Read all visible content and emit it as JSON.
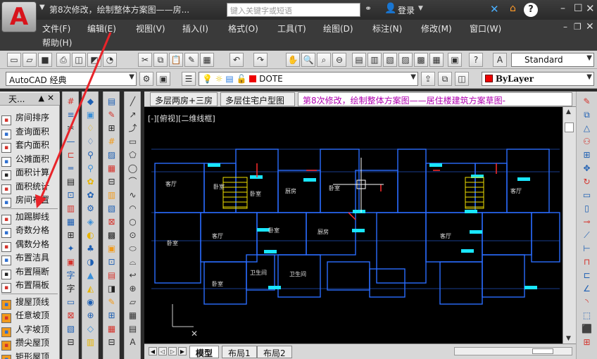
{
  "title_bar": {
    "app_logo": "A",
    "title": "第8次修改，绘制整体方案图——房...",
    "search_placeholder": "键入关键字或短语",
    "login": "登录",
    "help": "?",
    "icons": [
      "binoculars-icon",
      "user-icon",
      "exchange-icon",
      "store-icon",
      "help-icon"
    ]
  },
  "menu": {
    "items": [
      "文件(F)",
      "编辑(E)",
      "视图(V)",
      "插入(I)",
      "格式(O)",
      "工具(T)",
      "绘图(D)",
      "标注(N)",
      "修改(M)",
      "窗口(W)"
    ],
    "help": "帮助(H)"
  },
  "toolbar": {
    "text_style": "Standard",
    "workspace": "AutoCAD 经典",
    "layer": "DOTE",
    "color": "ByLayer"
  },
  "palette": {
    "title": "天...",
    "items": [
      {
        "label": "房间排序",
        "icon": "room-sort-icon"
      },
      {
        "label": "查询面积",
        "icon": "query-area-icon"
      },
      {
        "label": "套内面积",
        "icon": "suite-area-icon"
      },
      {
        "label": "公摊面积",
        "icon": "shared-area-icon"
      },
      {
        "label": "面积计算",
        "icon": "area-calc-icon"
      },
      {
        "label": "面积统计",
        "icon": "area-stats-icon"
      },
      {
        "label": "房间布置",
        "icon": "room-layout-icon"
      },
      {
        "label": "加踢脚线",
        "icon": "baseboard-icon"
      },
      {
        "label": "奇数分格",
        "icon": "odd-grid-icon"
      },
      {
        "label": "偶数分格",
        "icon": "even-grid-icon"
      },
      {
        "label": "布置洁具",
        "icon": "sanitary-icon"
      },
      {
        "label": "布置隔断",
        "icon": "partition-icon"
      },
      {
        "label": "布置隔板",
        "icon": "panel-icon"
      },
      {
        "label": "搜屋顶线",
        "icon": "roofline-icon"
      },
      {
        "label": "任意坡顶",
        "icon": "slope-roof-icon"
      },
      {
        "label": "人字坡顶",
        "icon": "gable-roof-icon"
      },
      {
        "label": "攒尖屋顶",
        "icon": "pyramid-roof-icon"
      },
      {
        "label": "矩形屋顶",
        "icon": "rect-roof-icon"
      }
    ]
  },
  "doc_tabs": [
    "多层两房+三房",
    "多层住宅户型图",
    "第8次修改，绘制整体方案图——居住楼建筑方案草图-"
  ],
  "viewport": {
    "label": "[-][俯视][二维线框]",
    "room_labels": [
      "客厅",
      "卧室",
      "卧室",
      "厨房",
      "卧室",
      "客厅",
      "卧室",
      "卧室",
      "厨房",
      "卧室",
      "卫生间",
      "卫生间",
      "客厅",
      "客厅"
    ]
  },
  "layout_tabs": [
    "模型",
    "布局1",
    "布局2"
  ],
  "colors": {
    "title_bg": "#2f2f2f",
    "toolbar_bg": "#d6d6d6",
    "canvas_bg": "#000000",
    "plan_lines": "#2a6cff",
    "cyan": "#19e6ff",
    "red_arrow": "#e8242a",
    "active_tab_text": "#b000b0"
  }
}
